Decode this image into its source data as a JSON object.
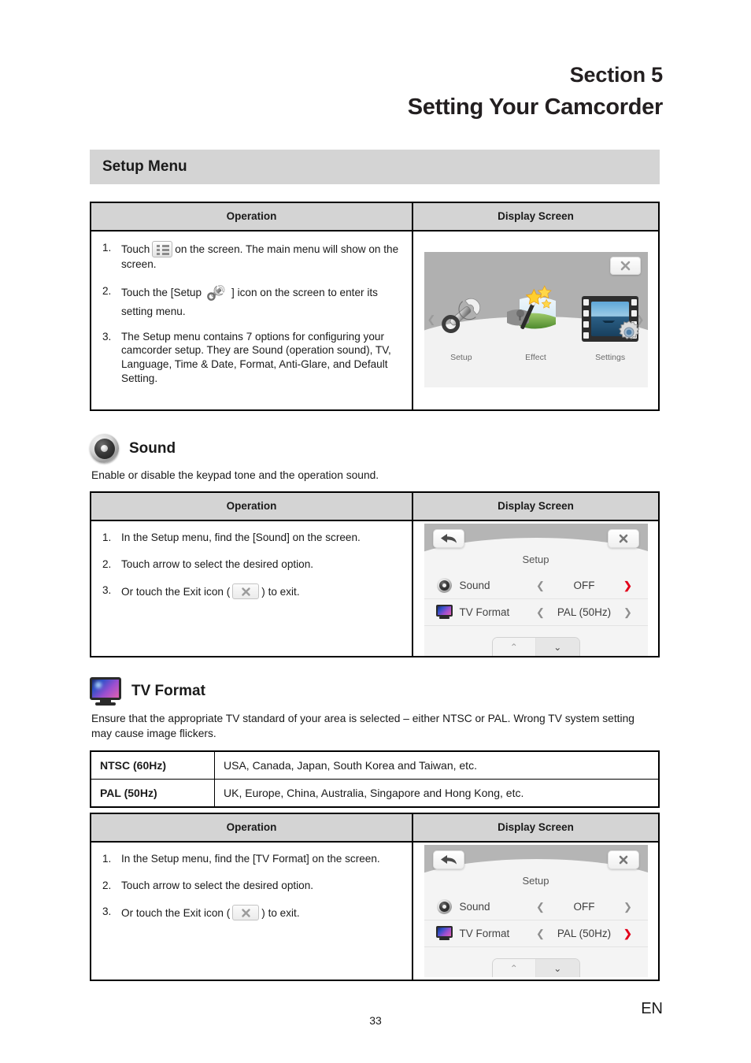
{
  "header": {
    "section_label": "Section 5",
    "title": "Setting Your Camcorder"
  },
  "banner": {
    "title": "Setup Menu"
  },
  "table_headers": {
    "operation": "Operation",
    "display_screen": "Display Screen"
  },
  "setup_menu_table": {
    "steps": [
      {
        "num": "1.",
        "text_before": "Touch",
        "icon": "menu-list-icon",
        "text_after": "on the screen. The main menu will show on the screen."
      },
      {
        "num": "2.",
        "text_before": "Touch the [Setup",
        "icon": "wrench-icon",
        "text_after": "] icon on the screen to enter its setting menu."
      },
      {
        "num": "3.",
        "text_before": "The Setup menu contains 7 options for configuring your camcorder setup. They are Sound (operation sound), TV, Language, Time & Date, Format, Anti-Glare, and Default Setting.",
        "icon": "",
        "text_after": ""
      }
    ],
    "display": {
      "items": [
        {
          "label": "Setup",
          "icon": "wrench-icon"
        },
        {
          "label": "Effect",
          "icon": "magic-wand-icon"
        },
        {
          "label": "Settings",
          "icon": "filmstrip-gear-icon"
        }
      ],
      "close_icon": "close-icon",
      "prev_icon": "chevron-left-icon",
      "next_icon": "chevron-right-icon"
    }
  },
  "sound_section": {
    "title": "Sound",
    "icon": "speaker-icon",
    "description": "Enable or disable the keypad tone and the operation sound.",
    "steps": [
      {
        "num": "1.",
        "text_before": "In the Setup menu, find the [Sound] on the screen.",
        "icon": "",
        "text_after": ""
      },
      {
        "num": "2.",
        "text_before": "Touch arrow to select the desired option.",
        "icon": "",
        "text_after": ""
      },
      {
        "num": "3.",
        "text_before": "Or touch the Exit icon (",
        "icon": "exit-icon",
        "text_after": ") to exit."
      }
    ],
    "display": {
      "title": "Setup",
      "back_icon": "back-arrow-icon",
      "close_icon": "close-icon",
      "rows": [
        {
          "icon": "speaker-icon",
          "label": "Sound",
          "left_arrow": "❮",
          "value": "OFF",
          "right_arrow": "❯",
          "right_arrow_highlighted": true
        },
        {
          "icon": "tv-icon",
          "label": "TV Format",
          "left_arrow": "❮",
          "value": "PAL (50Hz)",
          "right_arrow": "❯",
          "right_arrow_highlighted": false
        }
      ],
      "nav_up": "⌃",
      "nav_down": "⌄"
    }
  },
  "tv_format_section": {
    "title": "TV Format",
    "icon": "tv-icon",
    "description": "Ensure that the appropriate TV standard of your area is selected – either NTSC or PAL. Wrong TV system setting may cause image flickers.",
    "standards_table": [
      {
        "standard": "NTSC (60Hz)",
        "regions": "USA, Canada, Japan, South Korea and Taiwan, etc."
      },
      {
        "standard": "PAL (50Hz)",
        "regions": "UK, Europe, China, Australia, Singapore and Hong Kong, etc."
      }
    ],
    "steps": [
      {
        "num": "1.",
        "text_before": "In the Setup menu, find the [TV Format] on the screen.",
        "icon": "",
        "text_after": ""
      },
      {
        "num": "2.",
        "text_before": "Touch arrow to select the desired option.",
        "icon": "",
        "text_after": ""
      },
      {
        "num": "3.",
        "text_before": "Or touch the Exit icon (",
        "icon": "exit-icon",
        "text_after": ") to exit."
      }
    ],
    "display": {
      "title": "Setup",
      "back_icon": "back-arrow-icon",
      "close_icon": "close-icon",
      "rows": [
        {
          "icon": "speaker-icon",
          "label": "Sound",
          "left_arrow": "❮",
          "value": "OFF",
          "right_arrow": "❯",
          "right_arrow_highlighted": false
        },
        {
          "icon": "tv-icon",
          "label": "TV Format",
          "left_arrow": "❮",
          "value": "PAL (50Hz)",
          "right_arrow": "❯",
          "right_arrow_highlighted": true
        }
      ],
      "nav_up": "⌃",
      "nav_down": "⌄"
    }
  },
  "footer": {
    "page_number": "33",
    "language": "EN"
  },
  "colors": {
    "banner_bg": "#d4d4d4",
    "header_bg": "#d4d4d4",
    "highlight_arrow": "#e2001a"
  }
}
